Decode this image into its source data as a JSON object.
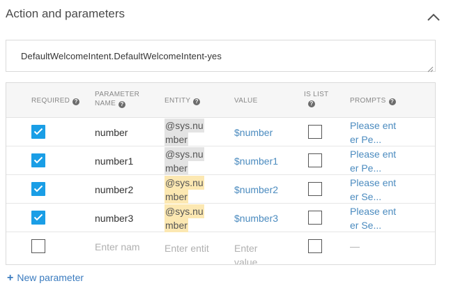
{
  "section": {
    "title": "Action and parameters"
  },
  "action": {
    "value": "DefaultWelcomeIntent.DefaultWelcomeIntent-yes"
  },
  "table": {
    "headers": {
      "required": "REQUIRED",
      "parameter_line1": "PARAMETER",
      "parameter_line2": "NAME",
      "entity": "ENTITY",
      "value": "VALUE",
      "islist": "IS LIST",
      "prompts": "PROMPTS"
    },
    "rows": [
      {
        "required": true,
        "name": "number",
        "entity_l1": "@sys.nu",
        "entity_l2": "mber",
        "entity_color": "grey",
        "value": "$number",
        "islist": false,
        "prompt_l1": "Please ent",
        "prompt_l2": "er Pe..."
      },
      {
        "required": true,
        "name": "number1",
        "entity_l1": "@sys.nu",
        "entity_l2": "mber",
        "entity_color": "grey",
        "value": "$number1",
        "islist": false,
        "prompt_l1": "Please ent",
        "prompt_l2": "er Pe..."
      },
      {
        "required": true,
        "name": "number2",
        "entity_l1": "@sys.nu",
        "entity_l2": "mber",
        "entity_color": "yellow",
        "value": "$number2",
        "islist": false,
        "prompt_l1": "Please ent",
        "prompt_l2": "er Se..."
      },
      {
        "required": true,
        "name": "number3",
        "entity_l1": "@sys.nu",
        "entity_l2": "mber",
        "entity_color": "yellow",
        "value": "$number3",
        "islist": false,
        "prompt_l1": "Please ent",
        "prompt_l2": "er Se..."
      }
    ],
    "new_row": {
      "name_placeholder": "Enter nam",
      "entity_placeholder": "Enter entit",
      "value_placeholder_l1": "Enter",
      "value_placeholder_l2": "value",
      "prompt_placeholder": "—"
    }
  },
  "footer": {
    "new_parameter": "New parameter",
    "plus": "+"
  },
  "colors": {
    "accent": "#1a9ee6",
    "link": "#4b8bbf",
    "entity_grey": "#e3e3e3",
    "entity_yellow": "#fce8b2"
  },
  "icons": {
    "collapse": "chevron-up-icon",
    "help": "help-circle-icon",
    "check": "checkmark-icon",
    "resize": "resize-handle-icon"
  }
}
